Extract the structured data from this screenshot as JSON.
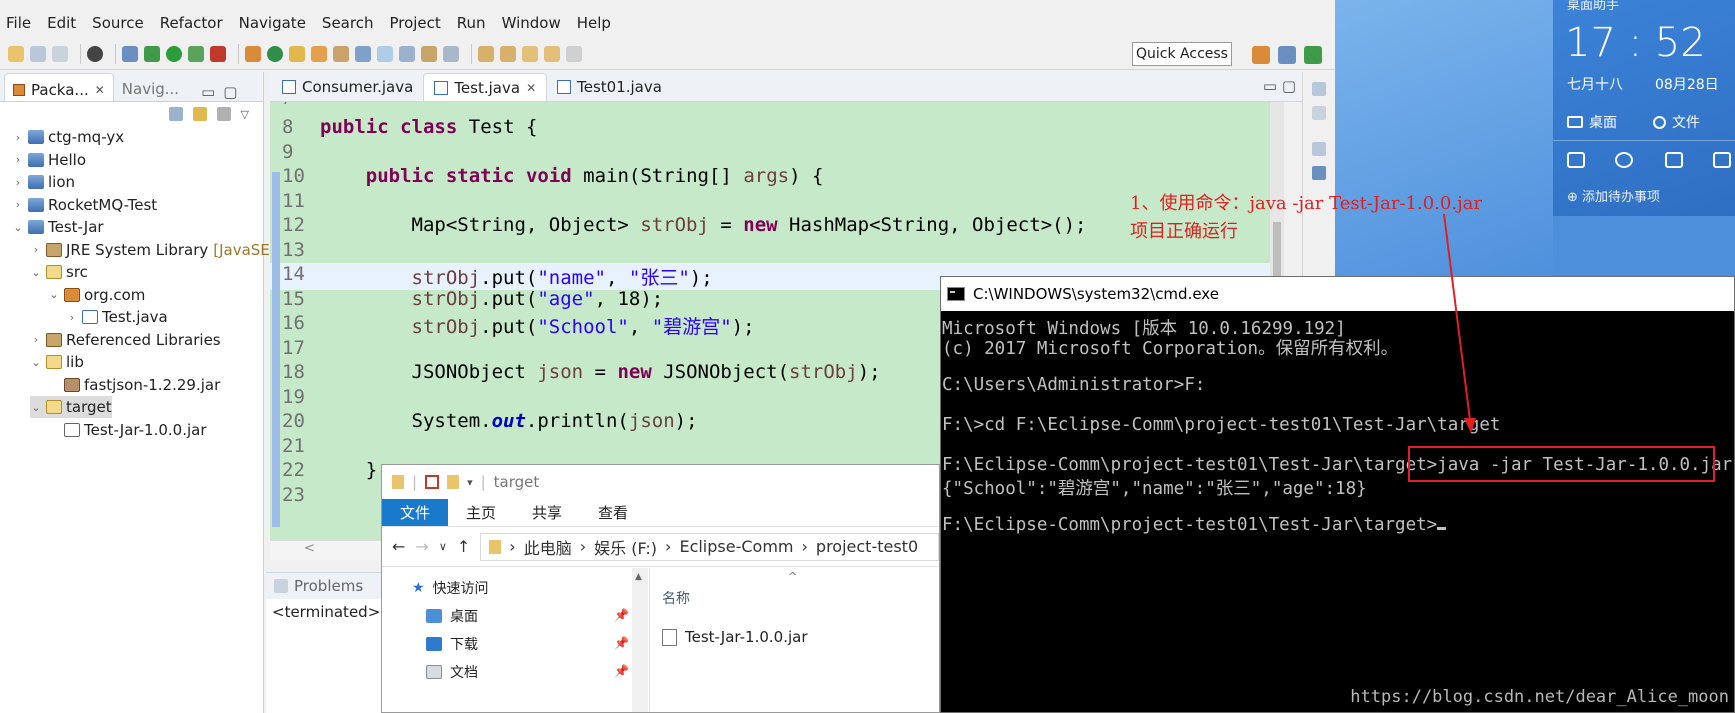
{
  "eclipse": {
    "menu": [
      "File",
      "Edit",
      "Source",
      "Refactor",
      "Navigate",
      "Search",
      "Project",
      "Run",
      "Window",
      "Help"
    ],
    "quick_access": "Quick Access",
    "package_explorer": {
      "tab_label": "Packa...",
      "other_tab_label": "Navig...",
      "tree": [
        {
          "label": "ctg-mq-yx",
          "level": 0,
          "toggle": ">"
        },
        {
          "label": "Hello",
          "level": 0,
          "toggle": ">"
        },
        {
          "label": "lion",
          "level": 0,
          "toggle": ">"
        },
        {
          "label": "RocketMQ-Test",
          "level": 0,
          "toggle": ">"
        },
        {
          "label": "Test-Jar",
          "level": 0,
          "toggle": "v"
        },
        {
          "label": "JRE System Library",
          "suffix": "[JavaSE",
          "level": 1,
          "toggle": ">"
        },
        {
          "label": "src",
          "level": 1,
          "toggle": "v"
        },
        {
          "label": "org.com",
          "level": 2,
          "toggle": "v"
        },
        {
          "label": "Test.java",
          "level": 3,
          "toggle": ">"
        },
        {
          "label": "Referenced Libraries",
          "level": 1,
          "toggle": ">"
        },
        {
          "label": "lib",
          "level": 1,
          "toggle": "v"
        },
        {
          "label": "fastjson-1.2.29.jar",
          "level": 2,
          "toggle": ""
        },
        {
          "label": "target",
          "level": 1,
          "toggle": "v"
        },
        {
          "label": "Test-Jar-1.0.0.jar",
          "level": 2,
          "toggle": ""
        }
      ]
    },
    "editor_tabs": [
      {
        "label": "Consumer.java",
        "active": false
      },
      {
        "label": "Test.java",
        "active": true
      },
      {
        "label": "Test01.java",
        "active": false
      }
    ],
    "code_lines": [
      {
        "num": "8"
      },
      {
        "num": "9"
      },
      {
        "num": "10"
      },
      {
        "num": "11"
      },
      {
        "num": "12"
      },
      {
        "num": "13"
      },
      {
        "num": "14"
      },
      {
        "num": "15"
      },
      {
        "num": "16"
      },
      {
        "num": "17"
      },
      {
        "num": "18"
      },
      {
        "num": "19"
      },
      {
        "num": "20"
      },
      {
        "num": "21"
      },
      {
        "num": "22"
      },
      {
        "num": "23"
      }
    ],
    "code_text": {
      "l8": "public class Test {",
      "l10": "public static void main(String[] args) {",
      "l12": "Map<String, Object> strObj = new HashMap<String, Object>();",
      "l14": "strObj.put(\"name\", \"张三\");",
      "l15": "strObj.put(\"age\", 18);",
      "l16": "strObj.put(\"School\", \"碧游宫\");",
      "l18": "JSONObject json = new JSONObject(strObj);",
      "l20": "System.out.println(json);",
      "l22": "}"
    },
    "bottom": {
      "tab": "Problems",
      "content": "<terminated>"
    }
  },
  "annotation": {
    "line1": "1、使用命令：java -jar Test-Jar-1.0.0.jar",
    "line2": "项目正确运行"
  },
  "widget": {
    "title": "桌面助手",
    "time": "17 : 52",
    "lunar": "七月十八",
    "date": "08月28日",
    "desktop_btn": "桌面",
    "file_btn": "文件",
    "todo": "添加待办事项"
  },
  "cmd": {
    "title": "C:\\WINDOWS\\system32\\cmd.exe",
    "lines": [
      "Microsoft Windows [版本 10.0.16299.192]",
      "(c) 2017 Microsoft Corporation。保留所有权利。",
      "",
      "C:\\Users\\Administrator>F:",
      "",
      "F:\\>cd F:\\Eclipse-Comm\\project-test01\\Test-Jar\\target",
      "",
      "F:\\Eclipse-Comm\\project-test01\\Test-Jar\\target>java -jar Test-Jar-1.0.0.jar",
      "{\"School\":\"碧游宫\",\"name\":\"张三\",\"age\":18}",
      "",
      "F:\\Eclipse-Comm\\project-test01\\Test-Jar\\target>"
    ]
  },
  "explorer": {
    "title": "target",
    "ribbon": [
      "文件",
      "主页",
      "共享",
      "查看"
    ],
    "breadcrumb": [
      "此电脑",
      "娱乐 (F:)",
      "Eclipse-Comm",
      "project-test0"
    ],
    "quick_access": "快速访问",
    "nav_items": [
      "桌面",
      "下载",
      "文档"
    ],
    "column_name": "名称",
    "file": "Test-Jar-1.0.0.jar"
  },
  "watermark": "https://blog.csdn.net/dear_Alice_moon"
}
